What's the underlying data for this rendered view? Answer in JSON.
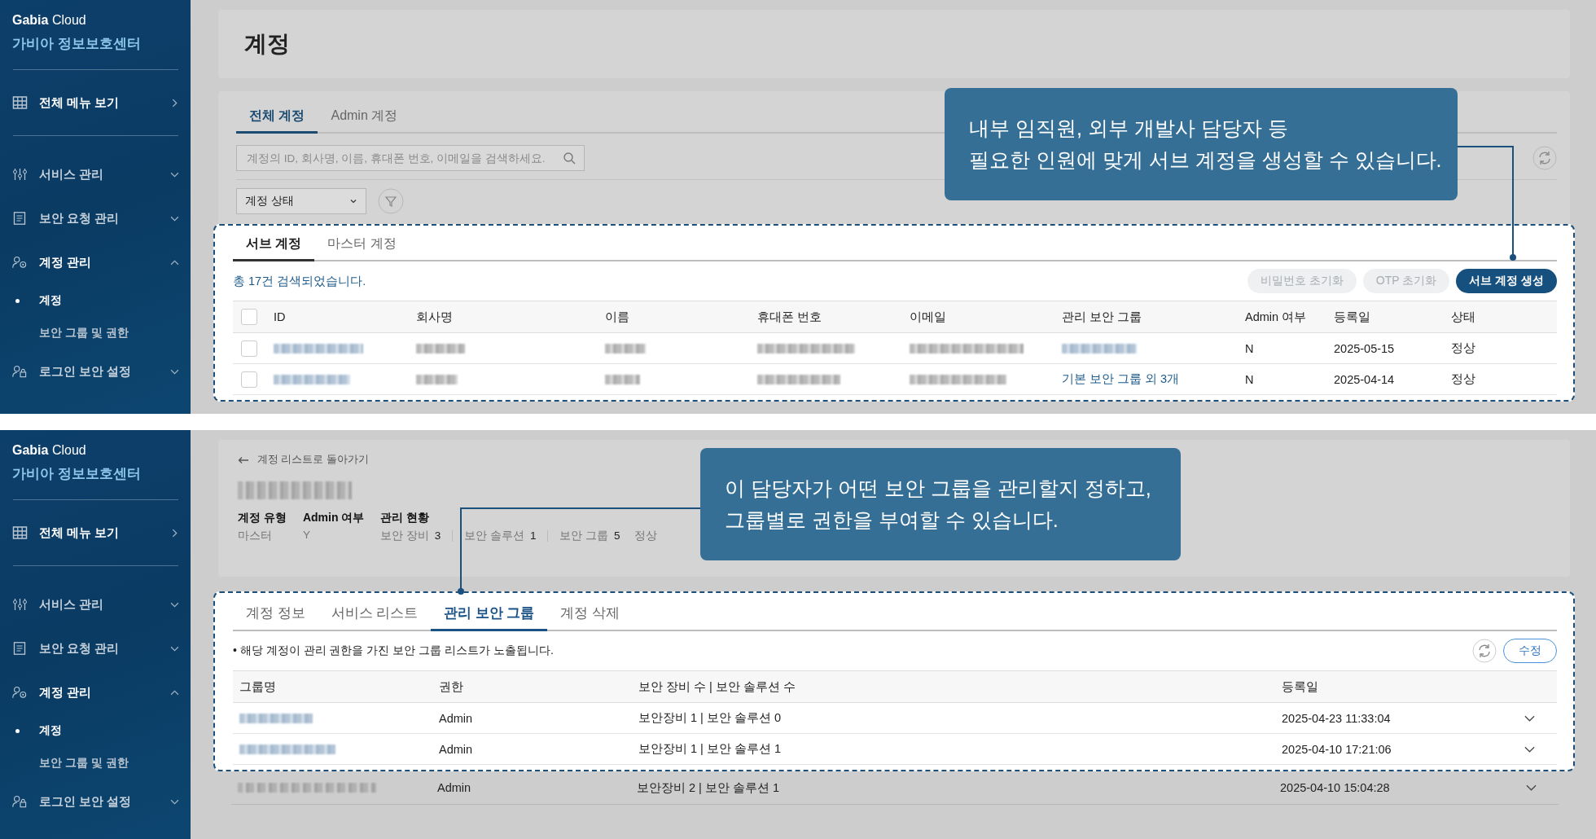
{
  "top_panel": {
    "sidebar": {
      "brand": "**Gabia** Cloud",
      "subtitle": "가비아 정보보호센터",
      "all_menu": "전체 메뉴 보기",
      "items": [
        {
          "label": "서비스 관리",
          "kind": "sliders",
          "expanded": false
        },
        {
          "label": "보안 요청 관리",
          "kind": "document",
          "expanded": false
        },
        {
          "label": "계정 관리",
          "kind": "user-gear",
          "expanded": true,
          "children": [
            {
              "label": "계정",
              "selected": true
            },
            {
              "label": "보안 그룹 및 권한",
              "selected": false
            }
          ]
        },
        {
          "label": "로그인 보안 설정",
          "kind": "user-lock",
          "expanded": false
        }
      ]
    },
    "title": "계정",
    "tabs": [
      {
        "label": "전체 계정",
        "selected": true
      },
      {
        "label": "Admin 계정",
        "selected": false
      }
    ],
    "search": {
      "placeholder": "계정의 ID, 회사명, 이름, 휴대폰 번호, 이메일을 검색하세요."
    },
    "status_filter": "계정 상태",
    "sub_tabs": [
      {
        "label": "서브 계정",
        "selected": true
      },
      {
        "label": "마스터 계정",
        "selected": false
      }
    ],
    "result_count": "총 17건 검색되었습니다.",
    "buttons": [
      {
        "label": "비밀번호 초기화",
        "disabled": true
      },
      {
        "label": "OTP 초기화",
        "disabled": true
      },
      {
        "label": "서브 계정 생성",
        "disabled": false
      }
    ],
    "table": {
      "header_checked": false,
      "columns": [
        "ID",
        "회사명",
        "이름",
        "휴대폰 번호",
        "이메일",
        "관리 보안 그룹",
        "Admin 여부",
        "등록일",
        "상태"
      ],
      "rows": [
        {
          "checked": false,
          "admin": "N",
          "registered": "2025-05-15",
          "status": "정상"
        },
        {
          "checked": false,
          "group": "기본 보안 그룹 외 3개",
          "admin": "N",
          "registered": "2025-04-14",
          "status": "정상"
        }
      ]
    },
    "callout": [
      "내부 임직원, 외부 개발사 담당자 등",
      "필요한 인원에 맞게 서브 계정을 생성할 수 있습니다."
    ]
  },
  "bottom_panel": {
    "sidebar": {
      "brand": "**Gabia** Cloud",
      "subtitle": "가비아 정보보호센터",
      "all_menu": "전체 메뉴 보기",
      "items": [
        {
          "label": "서비스 관리",
          "kind": "sliders",
          "expanded": false
        },
        {
          "label": "보안 요청 관리",
          "kind": "document",
          "expanded": false
        },
        {
          "label": "계정 관리",
          "kind": "user-gear",
          "expanded": true,
          "children": [
            {
              "label": "계정",
              "selected": true
            },
            {
              "label": "보안 그룹 및 권한",
              "selected": false
            }
          ]
        },
        {
          "label": "로그인 보안 설정",
          "kind": "user-lock",
          "expanded": false
        }
      ]
    },
    "back_link": "계정 리스트로 돌아가기",
    "meta": [
      {
        "label": "계정 유형",
        "value": "마스터"
      },
      {
        "label": "Admin 여부",
        "value": "Y"
      },
      {
        "label": "관리 현황",
        "stats": [
          {
            "label": "보안 장비",
            "count": "3"
          },
          {
            "label": "보안 솔루션",
            "count": "1"
          },
          {
            "label": "보안 그룹",
            "count": "5"
          }
        ],
        "status": "정상"
      }
    ],
    "tabs": [
      {
        "label": "계정 정보",
        "selected": false
      },
      {
        "label": "서비스 리스트",
        "selected": false
      },
      {
        "label": "관리 보안 그룹",
        "selected": true
      },
      {
        "label": "계정 삭제",
        "selected": false
      }
    ],
    "note": "• 해당 계정이 관리 권한을 가진 보안 그룹 리스트가 노출됩니다.",
    "edit_button": "수정",
    "table": {
      "columns": [
        "그룹명",
        "권한",
        "보안 장비 수 | 보안 솔루션 수",
        "등록일"
      ],
      "rows": [
        {
          "role": "Admin",
          "counts": "보안장비 1 | 보안 솔루션 0",
          "registered": "2025-04-23 11:33:04"
        },
        {
          "role": "Admin",
          "counts": "보안장비 1 | 보안 솔루션 1",
          "registered": "2025-04-10 17:21:06"
        }
      ],
      "rows_below": [
        {
          "role": "Admin",
          "counts": "보안장비 2 | 보안 솔루션 1",
          "registered": "2025-04-10 15:04:28"
        }
      ]
    },
    "callout": [
      "이 담당자가 어떤 보안 그룹을 관리할지 정하고,",
      "그룹별로 권한을 부여할 수 있습니다."
    ]
  }
}
